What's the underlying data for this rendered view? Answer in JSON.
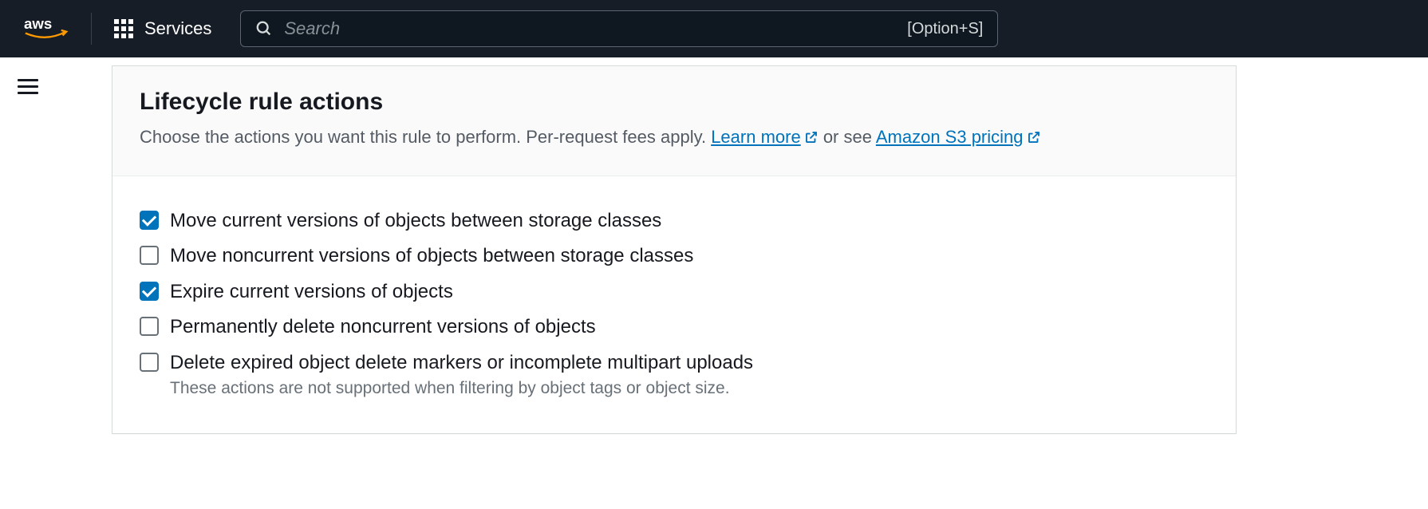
{
  "nav": {
    "services_label": "Services",
    "search_placeholder": "Search",
    "search_hint": "[Option+S]"
  },
  "panel": {
    "title": "Lifecycle rule actions",
    "description_prefix": "Choose the actions you want this rule to perform. Per-request fees apply. ",
    "learn_more": "Learn more",
    "description_mid": " or see ",
    "pricing_link": "Amazon S3 pricing",
    "checkboxes": [
      {
        "label": "Move current versions of objects between storage classes",
        "checked": true
      },
      {
        "label": "Move noncurrent versions of objects between storage classes",
        "checked": false
      },
      {
        "label": "Expire current versions of objects",
        "checked": true
      },
      {
        "label": "Permanently delete noncurrent versions of objects",
        "checked": false
      },
      {
        "label": "Delete expired object delete markers or incomplete multipart uploads",
        "checked": false
      }
    ],
    "helper": "These actions are not supported when filtering by object tags or object size."
  }
}
